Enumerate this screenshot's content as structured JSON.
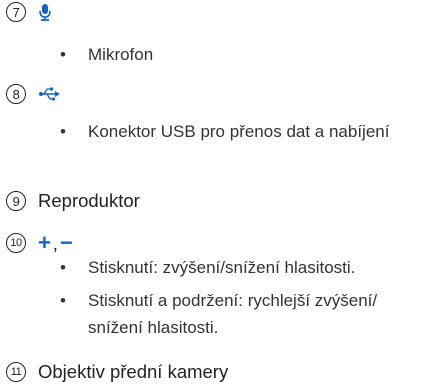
{
  "items": [
    {
      "number": "7",
      "icon": "microphone-icon",
      "bullets": [
        "Mikrofon"
      ]
    },
    {
      "number": "8",
      "icon": "usb-icon",
      "bullets": [
        "Konektor USB pro přenos dat a nabíjení"
      ]
    },
    {
      "number": "9",
      "heading": "Reproduktor"
    },
    {
      "number": "10",
      "symbols": {
        "plus": "+",
        "comma": ",",
        "minus": "−"
      },
      "bullets": [
        "Stisknutí: zvýšení/snížení hlasitosti.",
        "Stisknutí a podržení: rychlejší zvýšení/ snížení hlasitosti."
      ]
    },
    {
      "number": "11",
      "heading": "Objektiv přední kamery"
    }
  ],
  "colors": {
    "accent": "#1565c0",
    "text": "#222222"
  }
}
